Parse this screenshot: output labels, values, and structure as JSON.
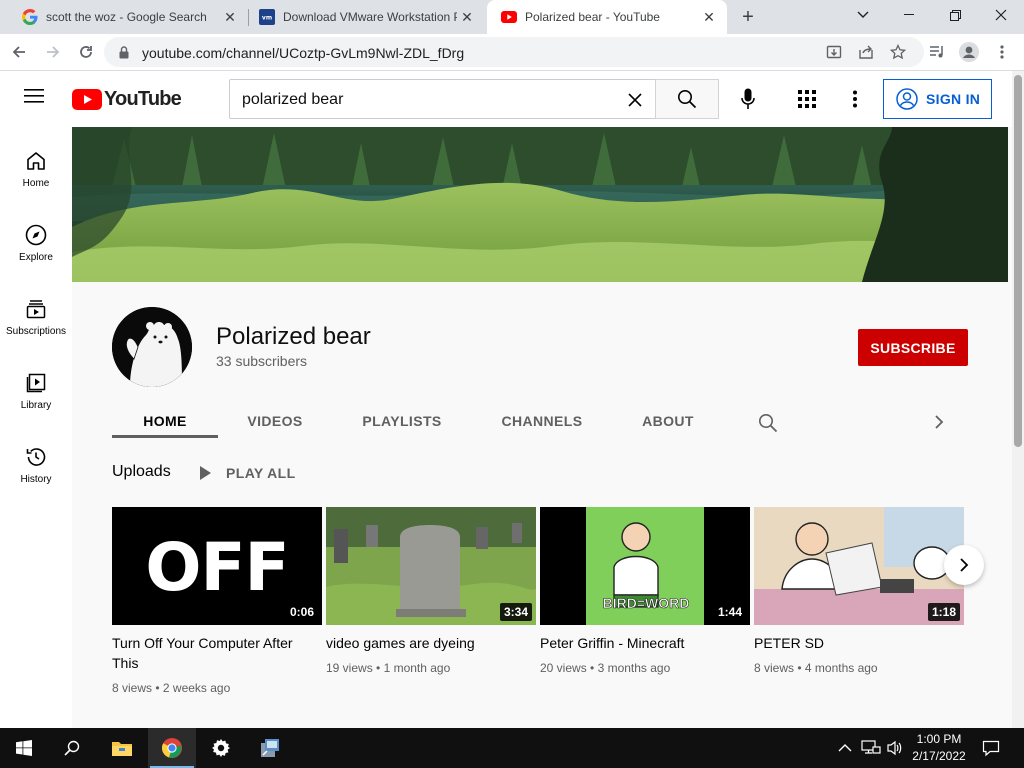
{
  "browser": {
    "tabs": [
      {
        "title": "scott the woz - Google Search",
        "icon": "google-icon"
      },
      {
        "title": "Download VMware Workstation Pro",
        "icon": "vmware-icon"
      },
      {
        "title": "Polarized bear - YouTube",
        "icon": "youtube-icon",
        "active": true
      }
    ],
    "url": "youtube.com/channel/UCoztp-GvLm9Nwl-ZDL_fDrg"
  },
  "youtube": {
    "search_query": "polarized bear",
    "sign_in_label": "SIGN IN",
    "logo_text": "YouTube",
    "guide": [
      {
        "label": "Home",
        "icon": "home-icon"
      },
      {
        "label": "Explore",
        "icon": "compass-icon"
      },
      {
        "label": "Subscriptions",
        "icon": "subscriptions-icon"
      },
      {
        "label": "Library",
        "icon": "library-icon"
      },
      {
        "label": "History",
        "icon": "history-icon"
      }
    ],
    "channel": {
      "name": "Polarized bear",
      "subscribers": "33 subscribers",
      "subscribe_label": "SUBSCRIBE",
      "tabs": [
        "HOME",
        "VIDEOS",
        "PLAYLISTS",
        "CHANNELS",
        "ABOUT"
      ],
      "active_tab": "HOME"
    },
    "uploads": {
      "title": "Uploads",
      "play_all": "PLAY ALL",
      "videos": [
        {
          "title": "Turn Off Your Computer After This",
          "duration": "0:06",
          "views": "8 views",
          "age": "2 weeks ago",
          "thumb_text": "OFF"
        },
        {
          "title": "video games are dyeing",
          "duration": "3:34",
          "views": "19 views",
          "age": "1 month ago"
        },
        {
          "title": "Peter Griffin - Minecraft",
          "duration": "1:44",
          "views": "20 views",
          "age": "3 months ago",
          "thumb_text": "BIRD=WORD"
        },
        {
          "title": "PETER SD",
          "duration": "1:18",
          "views": "8 views",
          "age": "4 months ago"
        }
      ]
    },
    "colors": {
      "brand_red": "#ff0000",
      "subscribe_red": "#cc0000",
      "link_blue": "#065fd4"
    }
  },
  "taskbar": {
    "time": "1:00 PM",
    "date": "2/17/2022"
  }
}
